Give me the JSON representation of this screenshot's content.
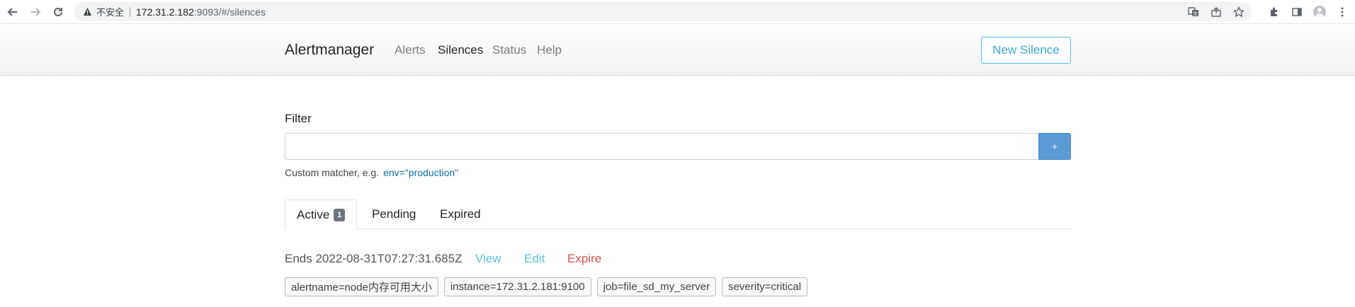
{
  "browser": {
    "security_label": "不安全",
    "url_host": "172.31.2.182",
    "url_rest": ":9093/#/silences",
    "icons": [
      "back-icon",
      "forward-icon",
      "reload-icon",
      "warning-icon",
      "translate-icon",
      "share-icon",
      "bookmark-star-icon",
      "extensions-icon",
      "sidepanel-icon",
      "profile-avatar",
      "menu-icon"
    ]
  },
  "navbar": {
    "brand": "Alertmanager",
    "links": [
      {
        "label": "Alerts",
        "active": false
      },
      {
        "label": "Silences",
        "active": true
      },
      {
        "label": "Status",
        "active": false
      },
      {
        "label": "Help",
        "active": false
      }
    ],
    "new_silence": "New Silence"
  },
  "filter": {
    "label": "Filter",
    "value": "",
    "add_button": "+",
    "hint_prefix": "Custom matcher, e.g.",
    "hint_example": "env=\"production\""
  },
  "tabs": [
    {
      "label": "Active",
      "badge": "1",
      "active": true
    },
    {
      "label": "Pending",
      "active": false
    },
    {
      "label": "Expired",
      "active": false
    }
  ],
  "silence": {
    "ends": "Ends 2022-08-31T07:27:31.685Z",
    "actions": {
      "view": "View",
      "edit": "Edit",
      "expire": "Expire"
    },
    "matchers": [
      "alertname=node内存可用大小",
      "instance=172.31.2.181:9100",
      "job=file_sd_my_server",
      "severity=critical"
    ]
  },
  "colors": {
    "accent_info": "#5bc0de",
    "danger": "#d9534f",
    "primary_button": "#5b9bd5",
    "badge": "#6c757d"
  }
}
